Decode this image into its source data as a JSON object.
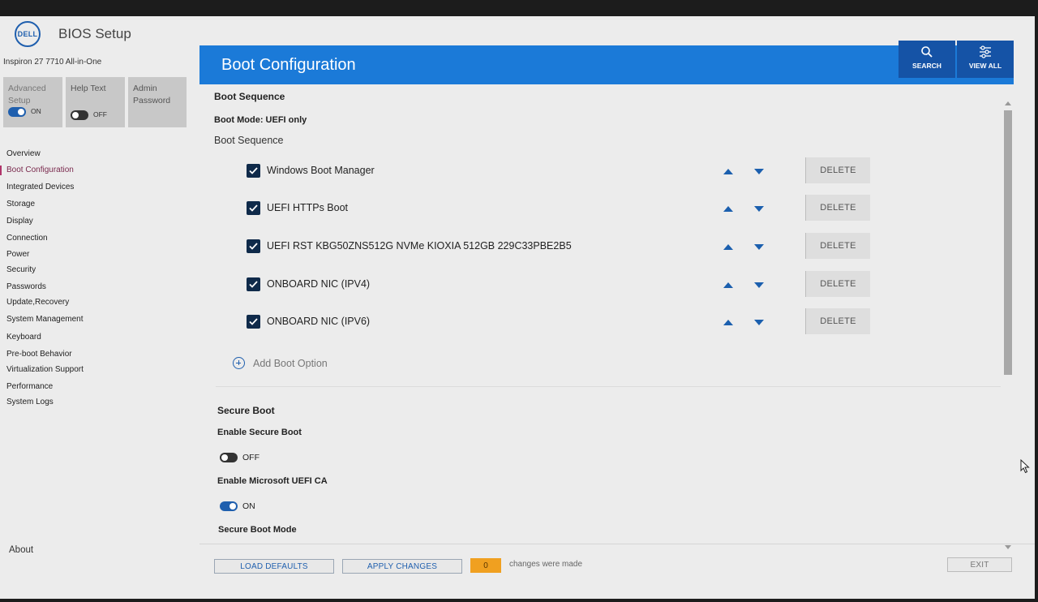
{
  "app": {
    "logo_text": "DELL",
    "title": "BIOS Setup",
    "model": "Inspiron 27 7710 All-in-One"
  },
  "modes": {
    "advanced": {
      "label": "Advanced Setup",
      "state": "ON"
    },
    "help": {
      "label": "Help Text",
      "state": "OFF"
    },
    "admin": {
      "label": "Admin Password"
    }
  },
  "nav": {
    "items": [
      {
        "label": "Overview",
        "active": false
      },
      {
        "label": "Boot Configuration",
        "active": true
      },
      {
        "label": "Integrated Devices",
        "active": false
      },
      {
        "label": "Storage",
        "active": false
      },
      {
        "label": "Display",
        "active": false
      },
      {
        "label": "Connection",
        "active": false
      },
      {
        "label": "Power",
        "active": false
      },
      {
        "label": "Security",
        "active": false
      },
      {
        "label": "Passwords",
        "active": false
      },
      {
        "label": "Update,Recovery",
        "active": false
      },
      {
        "label": "System Management",
        "active": false
      },
      {
        "label": "Keyboard",
        "active": false
      },
      {
        "label": "Pre-boot Behavior",
        "active": false
      },
      {
        "label": "Virtualization Support",
        "active": false
      },
      {
        "label": "Performance",
        "active": false
      },
      {
        "label": "System Logs",
        "active": false
      }
    ],
    "about": "About"
  },
  "header": {
    "title": "Boot Configuration",
    "search_label": "SEARCH",
    "viewall_label": "VIEW ALL"
  },
  "boot": {
    "section_title": "Boot Sequence",
    "mode": "Boot Mode: UEFI only",
    "sequence_label": "Boot Sequence",
    "delete_label": "DELETE",
    "options": [
      {
        "name": "Windows Boot Manager",
        "checked": true
      },
      {
        "name": "UEFI HTTPs Boot",
        "checked": true
      },
      {
        "name": "UEFI RST KBG50ZNS512G NVMe KIOXIA 512GB 229C33PBE2B5",
        "checked": true
      },
      {
        "name": "ONBOARD NIC (IPV4)",
        "checked": true
      },
      {
        "name": "ONBOARD NIC (IPV6)",
        "checked": true
      }
    ],
    "add_label": "Add Boot Option"
  },
  "secure_boot": {
    "section_title": "Secure Boot",
    "enable_label": "Enable Secure Boot",
    "enable_state": "OFF",
    "ms_ca_label": "Enable Microsoft UEFI CA",
    "ms_ca_state": "ON",
    "mode_label": "Secure Boot Mode"
  },
  "footer": {
    "load_defaults": "LOAD DEFAULTS",
    "apply_changes": "APPLY CHANGES",
    "changes_count": "0",
    "changes_text": "changes were made",
    "exit": "EXIT"
  },
  "colors": {
    "header_blue": "#1b7ad8",
    "header_button": "#1553a6",
    "accent": "#1f5fae",
    "changes_badge": "#f0a020"
  }
}
